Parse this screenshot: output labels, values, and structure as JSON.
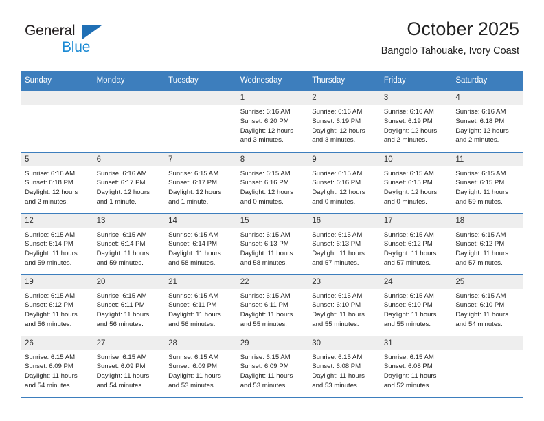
{
  "brand": {
    "name_dark": "General",
    "name_blue": "Blue",
    "triangle_icon": "triangle-icon",
    "accent_blue": "#1b8ad4",
    "logo_triangle_blue": "#1f6fb5"
  },
  "header": {
    "title": "October 2025",
    "subtitle": "Bangolo Tahouake, Ivory Coast"
  },
  "calendar": {
    "header_bg": "#3d7ebd",
    "daynum_bg": "#eeeeee",
    "weekday_headers": [
      "Sunday",
      "Monday",
      "Tuesday",
      "Wednesday",
      "Thursday",
      "Friday",
      "Saturday"
    ],
    "weeks": [
      [
        {
          "day": "",
          "lines": []
        },
        {
          "day": "",
          "lines": []
        },
        {
          "day": "",
          "lines": []
        },
        {
          "day": "1",
          "lines": [
            "Sunrise: 6:16 AM",
            "Sunset: 6:20 PM",
            "Daylight: 12 hours",
            "and 3 minutes."
          ]
        },
        {
          "day": "2",
          "lines": [
            "Sunrise: 6:16 AM",
            "Sunset: 6:19 PM",
            "Daylight: 12 hours",
            "and 3 minutes."
          ]
        },
        {
          "day": "3",
          "lines": [
            "Sunrise: 6:16 AM",
            "Sunset: 6:19 PM",
            "Daylight: 12 hours",
            "and 2 minutes."
          ]
        },
        {
          "day": "4",
          "lines": [
            "Sunrise: 6:16 AM",
            "Sunset: 6:18 PM",
            "Daylight: 12 hours",
            "and 2 minutes."
          ]
        }
      ],
      [
        {
          "day": "5",
          "lines": [
            "Sunrise: 6:16 AM",
            "Sunset: 6:18 PM",
            "Daylight: 12 hours",
            "and 2 minutes."
          ]
        },
        {
          "day": "6",
          "lines": [
            "Sunrise: 6:16 AM",
            "Sunset: 6:17 PM",
            "Daylight: 12 hours",
            "and 1 minute."
          ]
        },
        {
          "day": "7",
          "lines": [
            "Sunrise: 6:15 AM",
            "Sunset: 6:17 PM",
            "Daylight: 12 hours",
            "and 1 minute."
          ]
        },
        {
          "day": "8",
          "lines": [
            "Sunrise: 6:15 AM",
            "Sunset: 6:16 PM",
            "Daylight: 12 hours",
            "and 0 minutes."
          ]
        },
        {
          "day": "9",
          "lines": [
            "Sunrise: 6:15 AM",
            "Sunset: 6:16 PM",
            "Daylight: 12 hours",
            "and 0 minutes."
          ]
        },
        {
          "day": "10",
          "lines": [
            "Sunrise: 6:15 AM",
            "Sunset: 6:15 PM",
            "Daylight: 12 hours",
            "and 0 minutes."
          ]
        },
        {
          "day": "11",
          "lines": [
            "Sunrise: 6:15 AM",
            "Sunset: 6:15 PM",
            "Daylight: 11 hours",
            "and 59 minutes."
          ]
        }
      ],
      [
        {
          "day": "12",
          "lines": [
            "Sunrise: 6:15 AM",
            "Sunset: 6:14 PM",
            "Daylight: 11 hours",
            "and 59 minutes."
          ]
        },
        {
          "day": "13",
          "lines": [
            "Sunrise: 6:15 AM",
            "Sunset: 6:14 PM",
            "Daylight: 11 hours",
            "and 59 minutes."
          ]
        },
        {
          "day": "14",
          "lines": [
            "Sunrise: 6:15 AM",
            "Sunset: 6:14 PM",
            "Daylight: 11 hours",
            "and 58 minutes."
          ]
        },
        {
          "day": "15",
          "lines": [
            "Sunrise: 6:15 AM",
            "Sunset: 6:13 PM",
            "Daylight: 11 hours",
            "and 58 minutes."
          ]
        },
        {
          "day": "16",
          "lines": [
            "Sunrise: 6:15 AM",
            "Sunset: 6:13 PM",
            "Daylight: 11 hours",
            "and 57 minutes."
          ]
        },
        {
          "day": "17",
          "lines": [
            "Sunrise: 6:15 AM",
            "Sunset: 6:12 PM",
            "Daylight: 11 hours",
            "and 57 minutes."
          ]
        },
        {
          "day": "18",
          "lines": [
            "Sunrise: 6:15 AM",
            "Sunset: 6:12 PM",
            "Daylight: 11 hours",
            "and 57 minutes."
          ]
        }
      ],
      [
        {
          "day": "19",
          "lines": [
            "Sunrise: 6:15 AM",
            "Sunset: 6:12 PM",
            "Daylight: 11 hours",
            "and 56 minutes."
          ]
        },
        {
          "day": "20",
          "lines": [
            "Sunrise: 6:15 AM",
            "Sunset: 6:11 PM",
            "Daylight: 11 hours",
            "and 56 minutes."
          ]
        },
        {
          "day": "21",
          "lines": [
            "Sunrise: 6:15 AM",
            "Sunset: 6:11 PM",
            "Daylight: 11 hours",
            "and 56 minutes."
          ]
        },
        {
          "day": "22",
          "lines": [
            "Sunrise: 6:15 AM",
            "Sunset: 6:11 PM",
            "Daylight: 11 hours",
            "and 55 minutes."
          ]
        },
        {
          "day": "23",
          "lines": [
            "Sunrise: 6:15 AM",
            "Sunset: 6:10 PM",
            "Daylight: 11 hours",
            "and 55 minutes."
          ]
        },
        {
          "day": "24",
          "lines": [
            "Sunrise: 6:15 AM",
            "Sunset: 6:10 PM",
            "Daylight: 11 hours",
            "and 55 minutes."
          ]
        },
        {
          "day": "25",
          "lines": [
            "Sunrise: 6:15 AM",
            "Sunset: 6:10 PM",
            "Daylight: 11 hours",
            "and 54 minutes."
          ]
        }
      ],
      [
        {
          "day": "26",
          "lines": [
            "Sunrise: 6:15 AM",
            "Sunset: 6:09 PM",
            "Daylight: 11 hours",
            "and 54 minutes."
          ]
        },
        {
          "day": "27",
          "lines": [
            "Sunrise: 6:15 AM",
            "Sunset: 6:09 PM",
            "Daylight: 11 hours",
            "and 54 minutes."
          ]
        },
        {
          "day": "28",
          "lines": [
            "Sunrise: 6:15 AM",
            "Sunset: 6:09 PM",
            "Daylight: 11 hours",
            "and 53 minutes."
          ]
        },
        {
          "day": "29",
          "lines": [
            "Sunrise: 6:15 AM",
            "Sunset: 6:09 PM",
            "Daylight: 11 hours",
            "and 53 minutes."
          ]
        },
        {
          "day": "30",
          "lines": [
            "Sunrise: 6:15 AM",
            "Sunset: 6:08 PM",
            "Daylight: 11 hours",
            "and 53 minutes."
          ]
        },
        {
          "day": "31",
          "lines": [
            "Sunrise: 6:15 AM",
            "Sunset: 6:08 PM",
            "Daylight: 11 hours",
            "and 52 minutes."
          ]
        },
        {
          "day": "",
          "lines": []
        }
      ]
    ]
  }
}
